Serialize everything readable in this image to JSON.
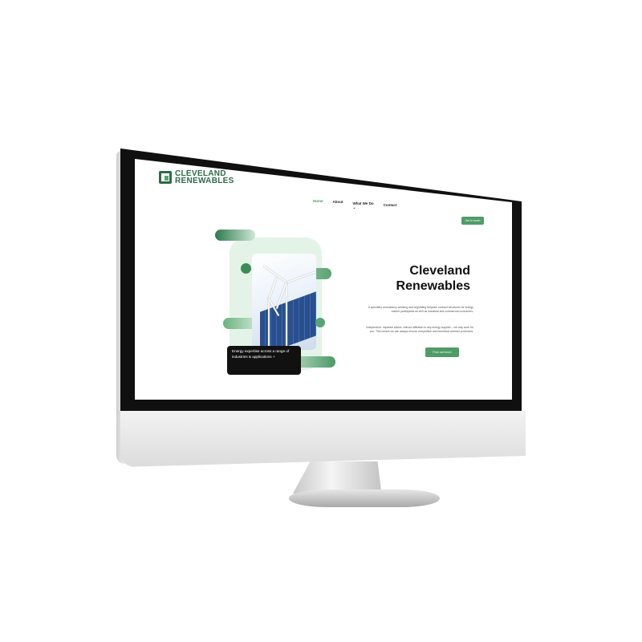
{
  "site": {
    "logo_line1": "CLEVELAND",
    "logo_line2": "RENEWABLES",
    "nav": [
      "Home",
      "About",
      "What We Do",
      "Contact"
    ],
    "nav_dropdown_glyph": "⌄",
    "top_cta": "Get in touch"
  },
  "hero": {
    "title_line1": "Cleveland",
    "title_line2": "Renewables",
    "paragraph1": "A specialist consultancy advising and originating bespoke contract structures for energy market participants as well as industrial and commercial consumers.",
    "paragraph2": "Independent. Impartial advice, without affiliation to any energy supplier – we only work for you. This means we can always ensure competitive and beneficial contract provisions.",
    "cta": "Find out more",
    "caption": "Energy expertise across a range of industries & applications",
    "caption_icon": "+"
  },
  "colors": {
    "brand_green": "#2d6b45",
    "accent_green": "#4f9c67"
  }
}
